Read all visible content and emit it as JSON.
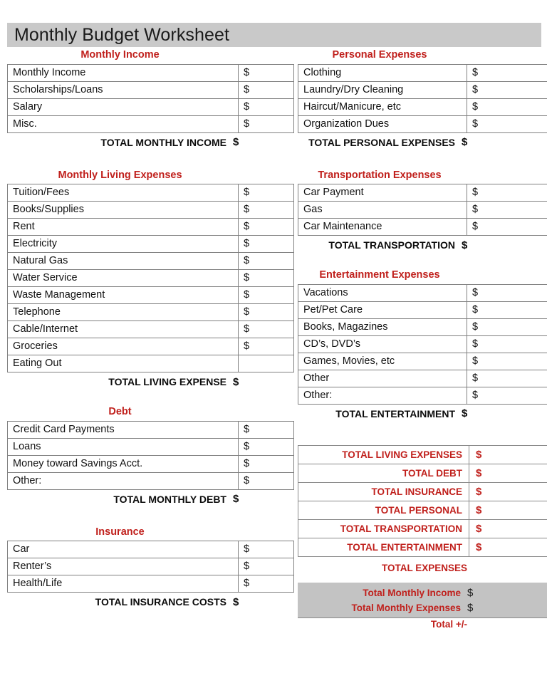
{
  "document": {
    "title": "Monthly Budget Worksheet",
    "currency_symbol": "$",
    "accent_red": "#c0201c",
    "title_band_color": "#c9c9c9",
    "summary_band_color": "#c3c3c3"
  },
  "sections": {
    "monthly_income": {
      "heading": "Monthly Income",
      "rows": [
        {
          "label": "Monthly Income",
          "amount": "$"
        },
        {
          "label": "Scholarships/Loans",
          "amount": "$"
        },
        {
          "label": "Salary",
          "amount": "$"
        },
        {
          "label": "Misc.",
          "amount": "$"
        }
      ],
      "total_label": "TOTAL MONTHLY INCOME",
      "total_amount": "$"
    },
    "monthly_living_expenses": {
      "heading": "Monthly Living Expenses",
      "rows": [
        {
          "label": "Tuition/Fees",
          "amount": "$"
        },
        {
          "label": "Books/Supplies",
          "amount": "$"
        },
        {
          "label": "Rent",
          "amount": "$"
        },
        {
          "label": "Electricity",
          "amount": "$"
        },
        {
          "label": "Natural Gas",
          "amount": "$"
        },
        {
          "label": "Water Service",
          "amount": "$"
        },
        {
          "label": "Waste Management",
          "amount": "$"
        },
        {
          "label": "Telephone",
          "amount": "$"
        },
        {
          "label": "Cable/Internet",
          "amount": "$"
        },
        {
          "label": "Groceries",
          "amount": "$"
        },
        {
          "label": "Eating Out",
          "amount": ""
        }
      ],
      "total_label": "TOTAL LIVING EXPENSE",
      "total_amount": "$"
    },
    "debt": {
      "heading": "Debt",
      "rows": [
        {
          "label": "Credit Card Payments",
          "amount": "$"
        },
        {
          "label": "Loans",
          "amount": "$"
        },
        {
          "label": "Money toward Savings Acct.",
          "amount": "$"
        },
        {
          "label": "Other:",
          "amount": "$"
        }
      ],
      "total_label": "TOTAL MONTHLY DEBT",
      "total_amount": "$"
    },
    "insurance": {
      "heading": "Insurance",
      "rows": [
        {
          "label": "Car",
          "amount": "$"
        },
        {
          "label": "Renter’s",
          "amount": "$"
        },
        {
          "label": "Health/Life",
          "amount": "$"
        }
      ],
      "total_label": "TOTAL INSURANCE COSTS",
      "total_amount": "$"
    },
    "personal_expenses": {
      "heading": "Personal Expenses",
      "rows": [
        {
          "label": "Clothing",
          "amount": "$"
        },
        {
          "label": "Laundry/Dry Cleaning",
          "amount": "$"
        },
        {
          "label": "Haircut/Manicure, etc",
          "amount": "$"
        },
        {
          "label": "Organization Dues",
          "amount": "$"
        }
      ],
      "total_label": "TOTAL PERSONAL EXPENSES",
      "total_amount": "$"
    },
    "transportation_expenses": {
      "heading": "Transportation Expenses",
      "rows": [
        {
          "label": "Car Payment",
          "amount": "$"
        },
        {
          "label": "Gas",
          "amount": "$"
        },
        {
          "label": "Car Maintenance",
          "amount": "$"
        }
      ],
      "total_label": "TOTAL TRANSPORTATION",
      "total_amount": "$"
    },
    "entertainment_expenses": {
      "heading": "Entertainment Expenses",
      "rows": [
        {
          "label": "Vacations",
          "amount": "$"
        },
        {
          "label": "Pet/Pet Care",
          "amount": "$"
        },
        {
          "label": "Books, Magazines",
          "amount": "$"
        },
        {
          "label": "CD’s, DVD’s",
          "amount": "$"
        },
        {
          "label": "Games, Movies, etc",
          "amount": "$"
        },
        {
          "label": "Other",
          "amount": "$"
        },
        {
          "label": "Other:",
          "amount": "$"
        }
      ],
      "total_label": "TOTAL ENTERTAINMENT",
      "total_amount": "$"
    }
  },
  "totals_summary": {
    "rows": [
      {
        "label": "TOTAL LIVING EXPENSES",
        "amount": "$"
      },
      {
        "label": "TOTAL DEBT",
        "amount": "$"
      },
      {
        "label": "TOTAL INSURANCE",
        "amount": "$"
      },
      {
        "label": "TOTAL PERSONAL",
        "amount": "$"
      },
      {
        "label": "TOTAL TRANSPORTATION",
        "amount": "$"
      },
      {
        "label": "TOTAL ENTERTAINMENT",
        "amount": "$"
      }
    ],
    "footer_label": "TOTAL EXPENSES"
  },
  "net_summary": {
    "rows": [
      {
        "label": "Total Monthly Income",
        "amount": "$"
      },
      {
        "label": "Total Monthly Expenses",
        "amount": "$"
      }
    ],
    "net_label": "Total +/-"
  }
}
